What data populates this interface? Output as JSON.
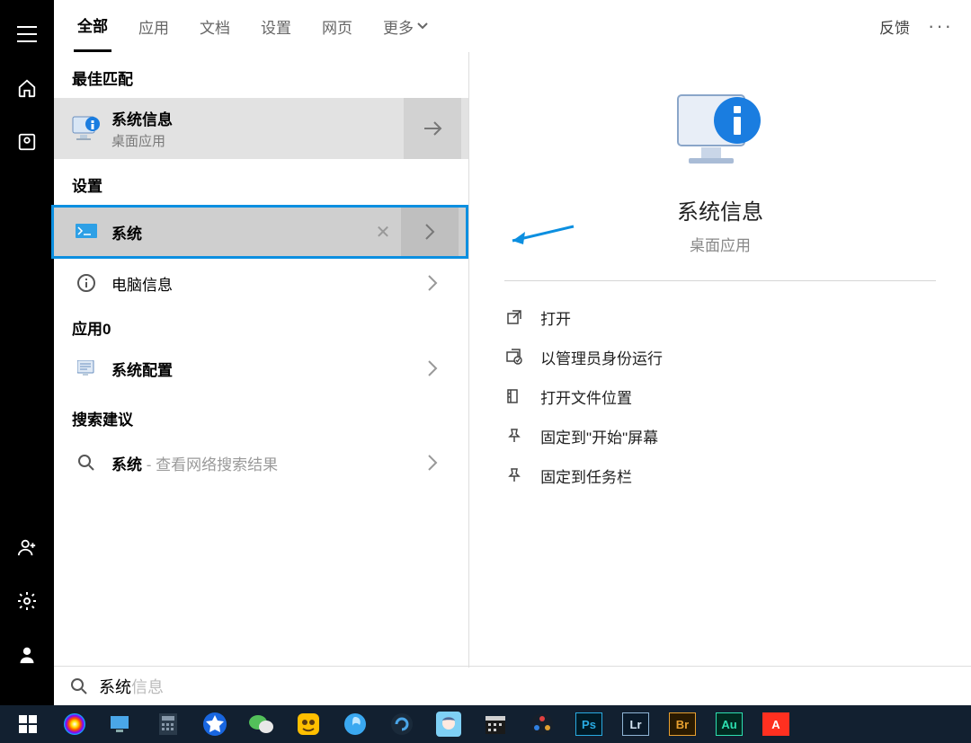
{
  "sidebar": {
    "menu": "menu",
    "home": "home",
    "library": "library",
    "user": "user",
    "gear": "gear",
    "person": "person"
  },
  "tabs": {
    "items": [
      "全部",
      "应用",
      "文档",
      "设置",
      "网页"
    ],
    "more": "更多",
    "feedback": "反馈"
  },
  "results": {
    "best_match_label": "最佳匹配",
    "best": {
      "title": "系统信息",
      "subtitle": "桌面应用"
    },
    "settings_label": "设置",
    "highlighted": {
      "title": "系统"
    },
    "settings_item": {
      "title": "电脑信息"
    },
    "apps_label": "应用0",
    "app_item": {
      "title": "系统配置"
    },
    "suggest_label": "搜索建议",
    "suggest": {
      "title": "系统",
      "hint": " - 查看网络搜索结果"
    }
  },
  "detail": {
    "name": "系统信息",
    "sub": "桌面应用",
    "actions": [
      {
        "icon": "open",
        "label": "打开"
      },
      {
        "icon": "admin",
        "label": "以管理员身份运行"
      },
      {
        "icon": "folder",
        "label": "打开文件位置"
      },
      {
        "icon": "pin",
        "label": "固定到\"开始\"屏幕"
      },
      {
        "icon": "pin",
        "label": "固定到任务栏"
      }
    ]
  },
  "search": {
    "typed": "系统",
    "ghost": "信息"
  },
  "taskbar": {
    "adobe": {
      "ps": "Ps",
      "lr": "Lr",
      "br": "Br",
      "au": "Au",
      "ai": "A"
    }
  }
}
